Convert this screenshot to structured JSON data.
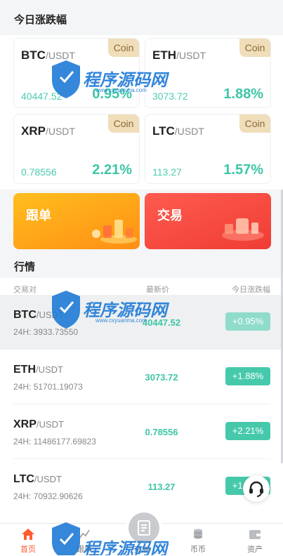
{
  "today_section": {
    "title": "今日涨跌幅"
  },
  "cards": [
    {
      "base": "BTC",
      "quote": "/USDT",
      "price": "40447.52",
      "change": "0.95%",
      "badge": "Coin"
    },
    {
      "base": "ETH",
      "quote": "/USDT",
      "price": "3073.72",
      "change": "1.88%",
      "badge": "Coin"
    },
    {
      "base": "XRP",
      "quote": "/USDT",
      "price": "0.78556",
      "change": "2.21%",
      "badge": "Coin"
    },
    {
      "base": "LTC",
      "quote": "/USDT",
      "price": "113.27",
      "change": "1.57%",
      "badge": "Coin"
    }
  ],
  "banners": {
    "follow": "跟单",
    "trade": "交易"
  },
  "market_section": {
    "title": "行情",
    "col_pair": "交易对",
    "col_last": "最新价",
    "col_change": "今日涨跌幅"
  },
  "market_rows": [
    {
      "base": "BTC",
      "quote": "/USDT",
      "vol": "24H: 3933.73550",
      "last": "40447.52",
      "change": "+0.95%"
    },
    {
      "base": "ETH",
      "quote": "/USDT",
      "vol": "24H: 51701.19073",
      "last": "3073.72",
      "change": "+1.88%"
    },
    {
      "base": "XRP",
      "quote": "/USDT",
      "vol": "24H: 11486177.69823",
      "last": "0.78556",
      "change": "+2.21%"
    },
    {
      "base": "LTC",
      "quote": "/USDT",
      "vol": "24H: 70932.90626",
      "last": "113.27",
      "change": "+1.57%"
    }
  ],
  "tabbar": {
    "home": "首页",
    "follow": "跟单",
    "trade": "交易",
    "coin": "币币",
    "assets": "资产"
  },
  "watermark": {
    "name": "程序源码网",
    "url": "www.cxyuanma.com"
  },
  "colors": {
    "accent": "#ff5b2e",
    "up": "#3ec6a6",
    "badge_bg": "#f0ddb9",
    "follow_banner": "#ff9f16",
    "trade_banner": "#f24a3c"
  }
}
